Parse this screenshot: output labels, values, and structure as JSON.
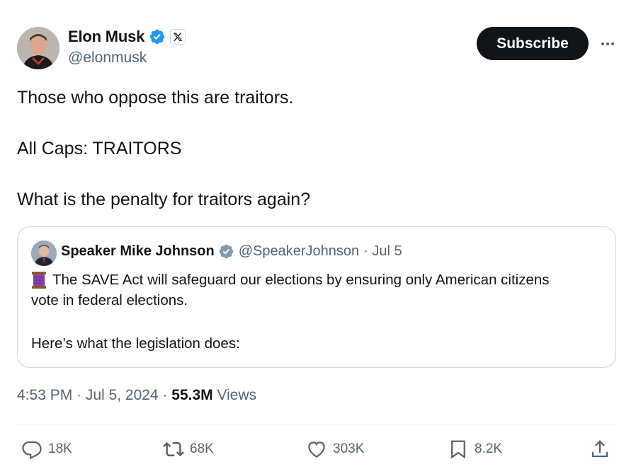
{
  "author": {
    "name": "Elon Musk",
    "handle": "@elonmusk"
  },
  "header": {
    "subscribe_label": "Subscribe"
  },
  "tweet": {
    "lines": [
      "Those who oppose this are traitors.",
      "All Caps: TRAITORS",
      "What is the penalty for traitors again?"
    ]
  },
  "quote": {
    "name": "Speaker Mike Johnson",
    "handle": "@SpeakerJohnson",
    "date": "· Jul 5",
    "emoji": "🧵",
    "line1": "The SAVE Act will safeguard our elections by ensuring only American citizens",
    "line2": "vote in federal elections.",
    "line3": "Here’s what the legislation does:"
  },
  "meta": {
    "time": "4:53 PM · Jul 5, 2024 ·",
    "views_count": "55.3M",
    "views_label": "Views"
  },
  "actions": {
    "replies": "18K",
    "reposts": "68K",
    "likes": "303K",
    "bookmarks": "8.2K"
  },
  "colors": {
    "verified_blue": "#1d9bf0",
    "verified_gray": "#829aab",
    "text_primary": "#0f1419",
    "text_secondary": "#536471",
    "border": "#cfd9de"
  },
  "icons": [
    "verified-badge-icon",
    "x-logo-icon",
    "more-icon",
    "reply-icon",
    "repost-icon",
    "like-icon",
    "bookmark-icon",
    "share-icon"
  ]
}
